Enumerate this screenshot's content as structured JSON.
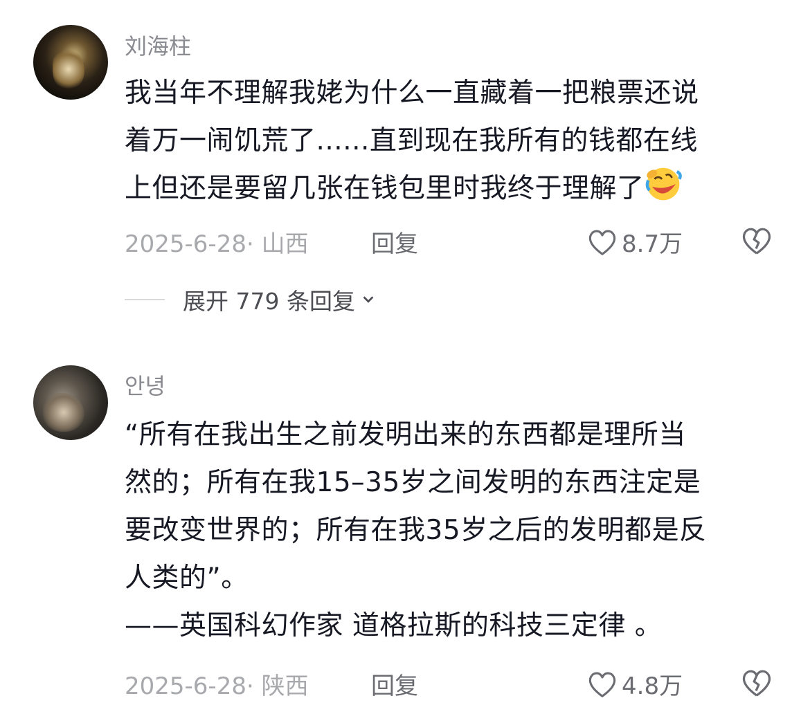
{
  "comments": [
    {
      "username": "刘海柱",
      "content_lines": [
        "我当年不理解我姥为什么一直藏着一把粮票还说",
        "着万一闹饥荒了......直到现在我所有的钱都在线",
        "上但还是要留几张在钱包里时我终于理解了"
      ],
      "emoji": "rolling-laughing-emoji",
      "date_location": "2025-6-28· 山西",
      "reply_label": "回复",
      "like_count": "8.7万",
      "expand_replies_label": "展开 779 条回复"
    },
    {
      "username": "안녕",
      "content_lines": [
        "“所有在我出生之前发明出来的东西都是理所当",
        "然的；所有在我15–35岁之间发明的东西注定是",
        "要改变世界的；所有在我35岁之后的发明都是反",
        "人类的”。",
        "——英国科幻作家 道格拉斯的科技三定律 。"
      ],
      "date_location": "2025-6-28· 陕西",
      "reply_label": "回复",
      "like_count": "4.8万"
    }
  ],
  "colors": {
    "text_primary": "#161823",
    "text_secondary": "#8a8b91",
    "meta_gray": "#a8a9ad",
    "background": "#ffffff"
  }
}
